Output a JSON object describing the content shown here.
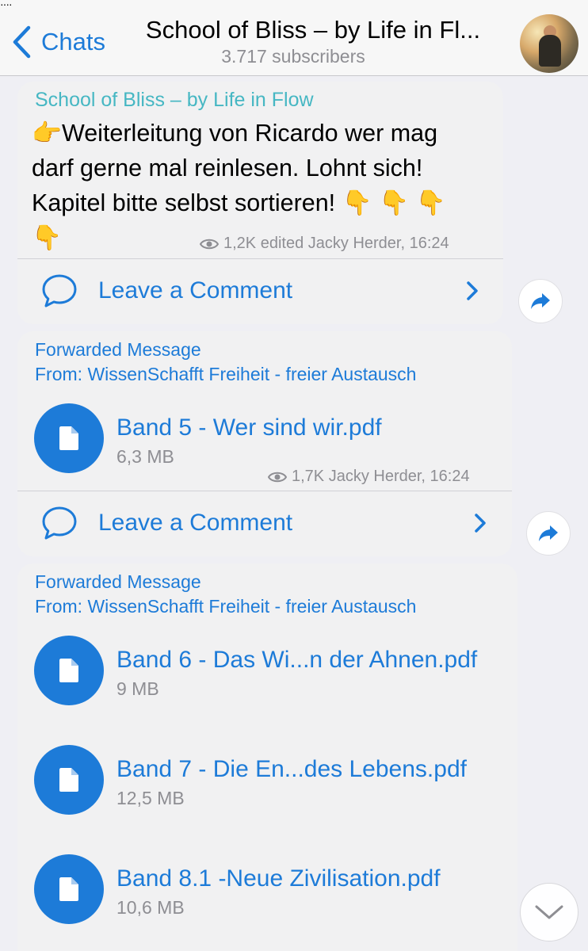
{
  "header": {
    "back_label": "Chats",
    "title": "School of Bliss – by Life in Fl...",
    "subtitle": "3.717 subscribers",
    "avatar_icon": "channel-avatar"
  },
  "messages": [
    {
      "sender": "School of Bliss – by Life in Flow",
      "text_lines": [
        "👉Weiterleitung von Ricardo wer mag",
        "darf gerne mal reinlesen. Lohnt sich!",
        "Kapitel bitte selbst sortieren! 👇 👇 👇",
        "👇"
      ],
      "views": "1,2K",
      "meta": "edited Jacky Herder, 16:24",
      "comment_label": "Leave a Comment"
    },
    {
      "forwarded_label": "Forwarded Message",
      "from_prefix": "From:",
      "from_name": "WissenSchafft Freiheit - freier Austausch",
      "files": [
        {
          "name": "Band 5 - Wer sind wir.pdf",
          "size": "6,3 MB"
        }
      ],
      "views": "1,7K",
      "meta": "Jacky Herder, 16:24",
      "comment_label": "Leave a Comment"
    },
    {
      "forwarded_label": "Forwarded Message",
      "from_prefix": "From:",
      "from_name": "WissenSchafft Freiheit - freier Austausch",
      "files": [
        {
          "name": "Band 6 - Das Wi...n der Ahnen.pdf",
          "size": "9 MB"
        },
        {
          "name": "Band 7 - Die En...des Lebens.pdf",
          "size": "12,5 MB"
        },
        {
          "name": "Band 8.1 -Neue Zivilisation.pdf",
          "size": "10,6 MB"
        }
      ]
    }
  ],
  "colors": {
    "accent": "#1d7bd8",
    "sender": "#46b7c3",
    "secondary_text": "#8e8e93",
    "bubble": "#f1f1f2",
    "background": "#efeff4"
  }
}
